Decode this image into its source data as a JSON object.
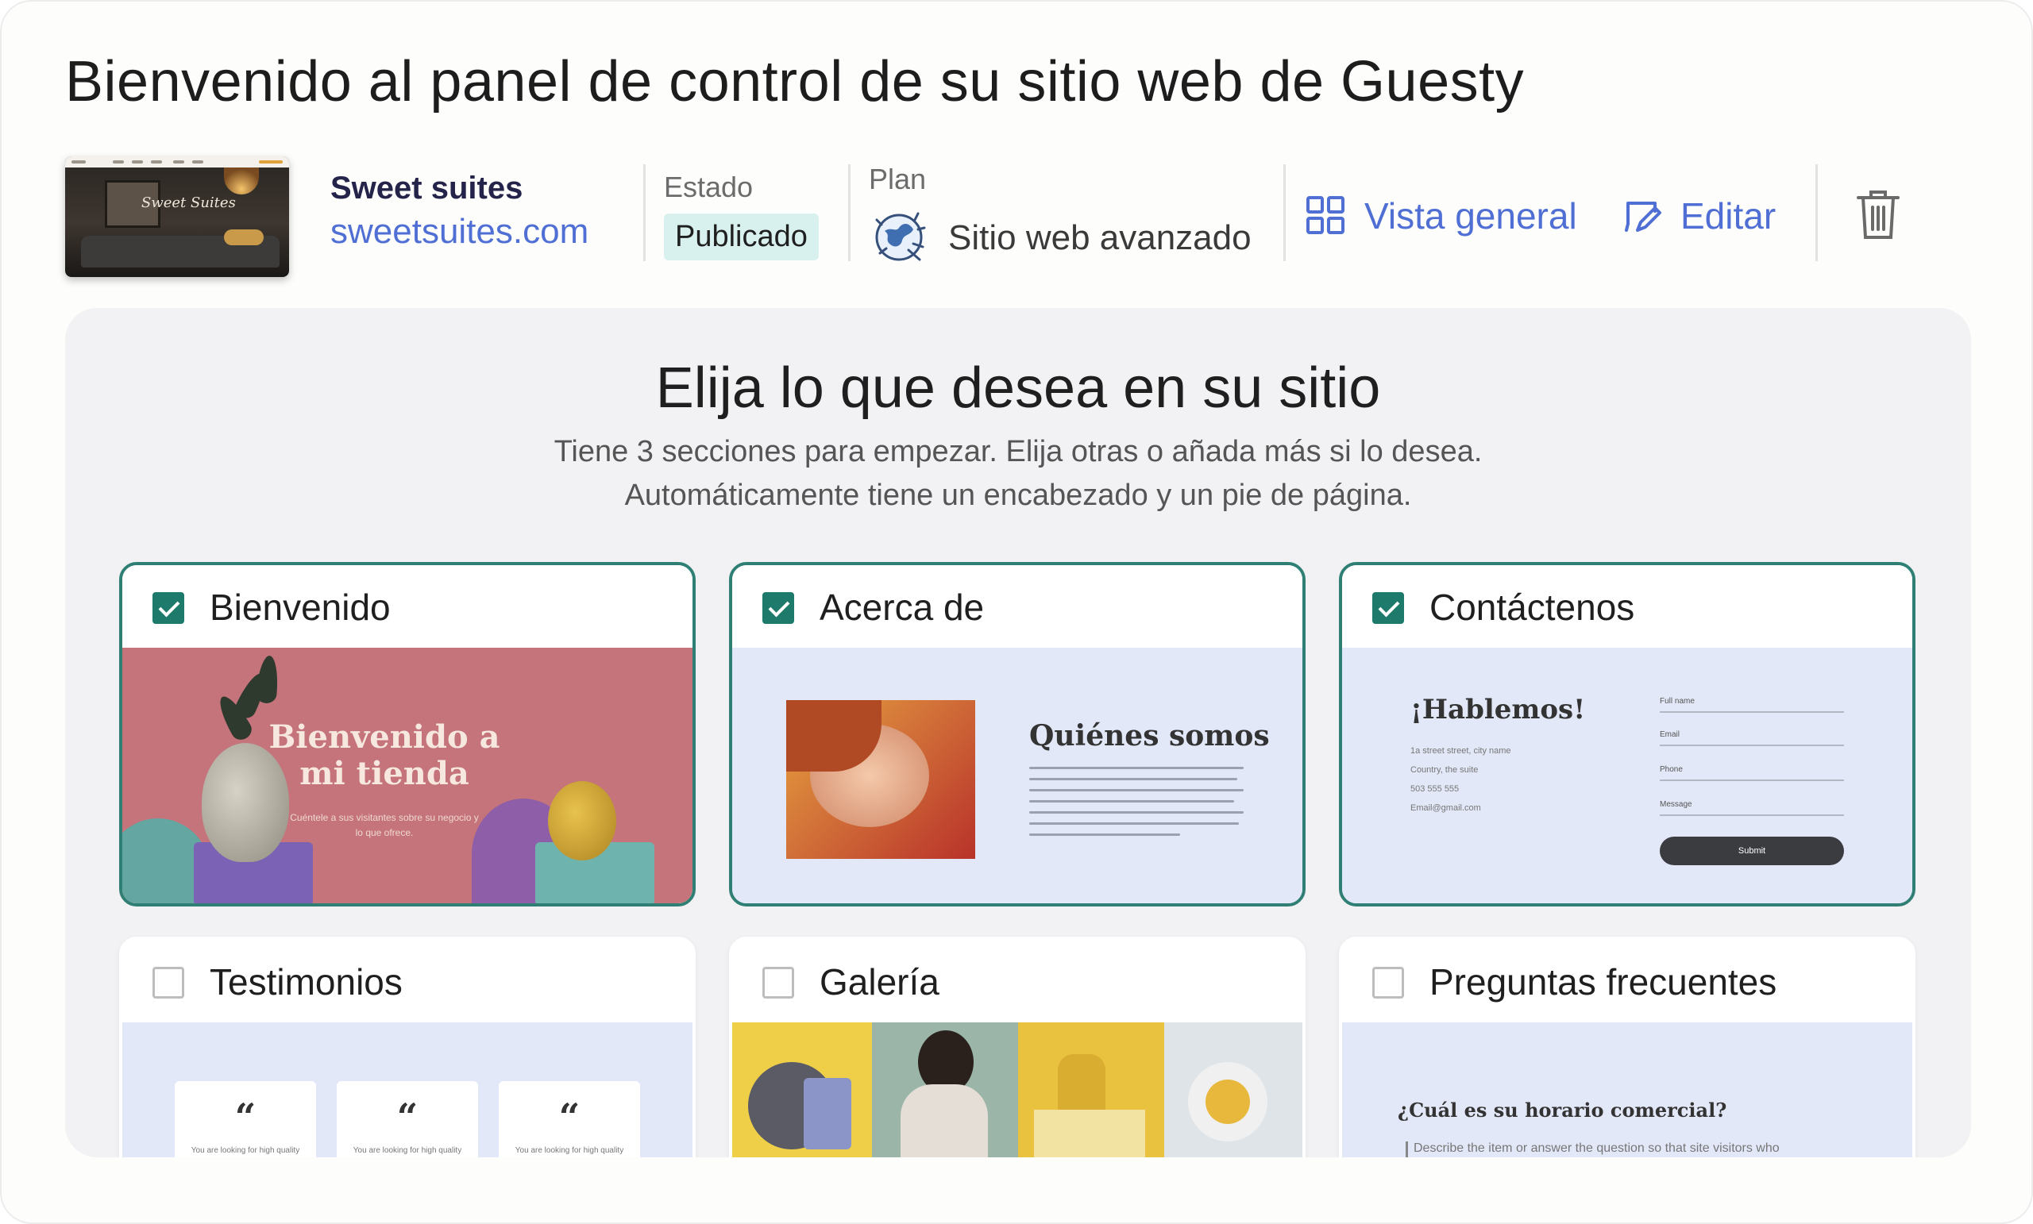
{
  "header": {
    "title": "Bienvenido al panel de control de su sitio web de Guesty"
  },
  "site": {
    "name": "Sweet suites",
    "domain": "sweetsuites.com",
    "thumb_script": "Sweet Suites",
    "status_label": "Estado",
    "status_value": "Publicado",
    "plan_label": "Plan",
    "plan_value": "Sitio web avanzado",
    "overview_label": "Vista general",
    "edit_label": "Editar"
  },
  "panel": {
    "title": "Elija lo que desea en su sitio",
    "subtitle_line1": "Tiene 3 secciones para empezar. Elija otras o añada más si lo desea.",
    "subtitle_line2": "Automáticamente tiene un encabezado y un pie de página."
  },
  "sections": [
    {
      "label": "Bienvenido",
      "checked": true
    },
    {
      "label": "Acerca de",
      "checked": true
    },
    {
      "label": "Contáctenos",
      "checked": true
    },
    {
      "label": "Testimonios",
      "checked": false
    },
    {
      "label": "Galería",
      "checked": false
    },
    {
      "label": "Preguntas frecuentes",
      "checked": false
    }
  ],
  "previews": {
    "welcome_title": "Bienvenido a mi tienda",
    "welcome_tagline": "Cuéntele a sus visitantes sobre su negocio y lo que ofrece.",
    "about_title": "Quiénes somos",
    "contact_title": "¡Hablemos!",
    "contact_info": [
      "1a street street, city name",
      "Country, the suite",
      "503 555 555",
      "Email@gmail.com"
    ],
    "contact_fields": [
      "Full name",
      "Email",
      "Phone",
      "Message"
    ],
    "contact_submit": "Submit",
    "testimonial_mark": "“",
    "testimonial_text": "You are looking for high quality",
    "faq_question": "¿Cuál es su horario comercial?",
    "faq_answer": "Describe the item or answer the question so that site visitors who"
  },
  "colors": {
    "accent": "#4f6fd4",
    "selected_border": "#2f7f74",
    "checkbox_on": "#1e7a6a",
    "badge_bg": "#d9f1ee"
  }
}
